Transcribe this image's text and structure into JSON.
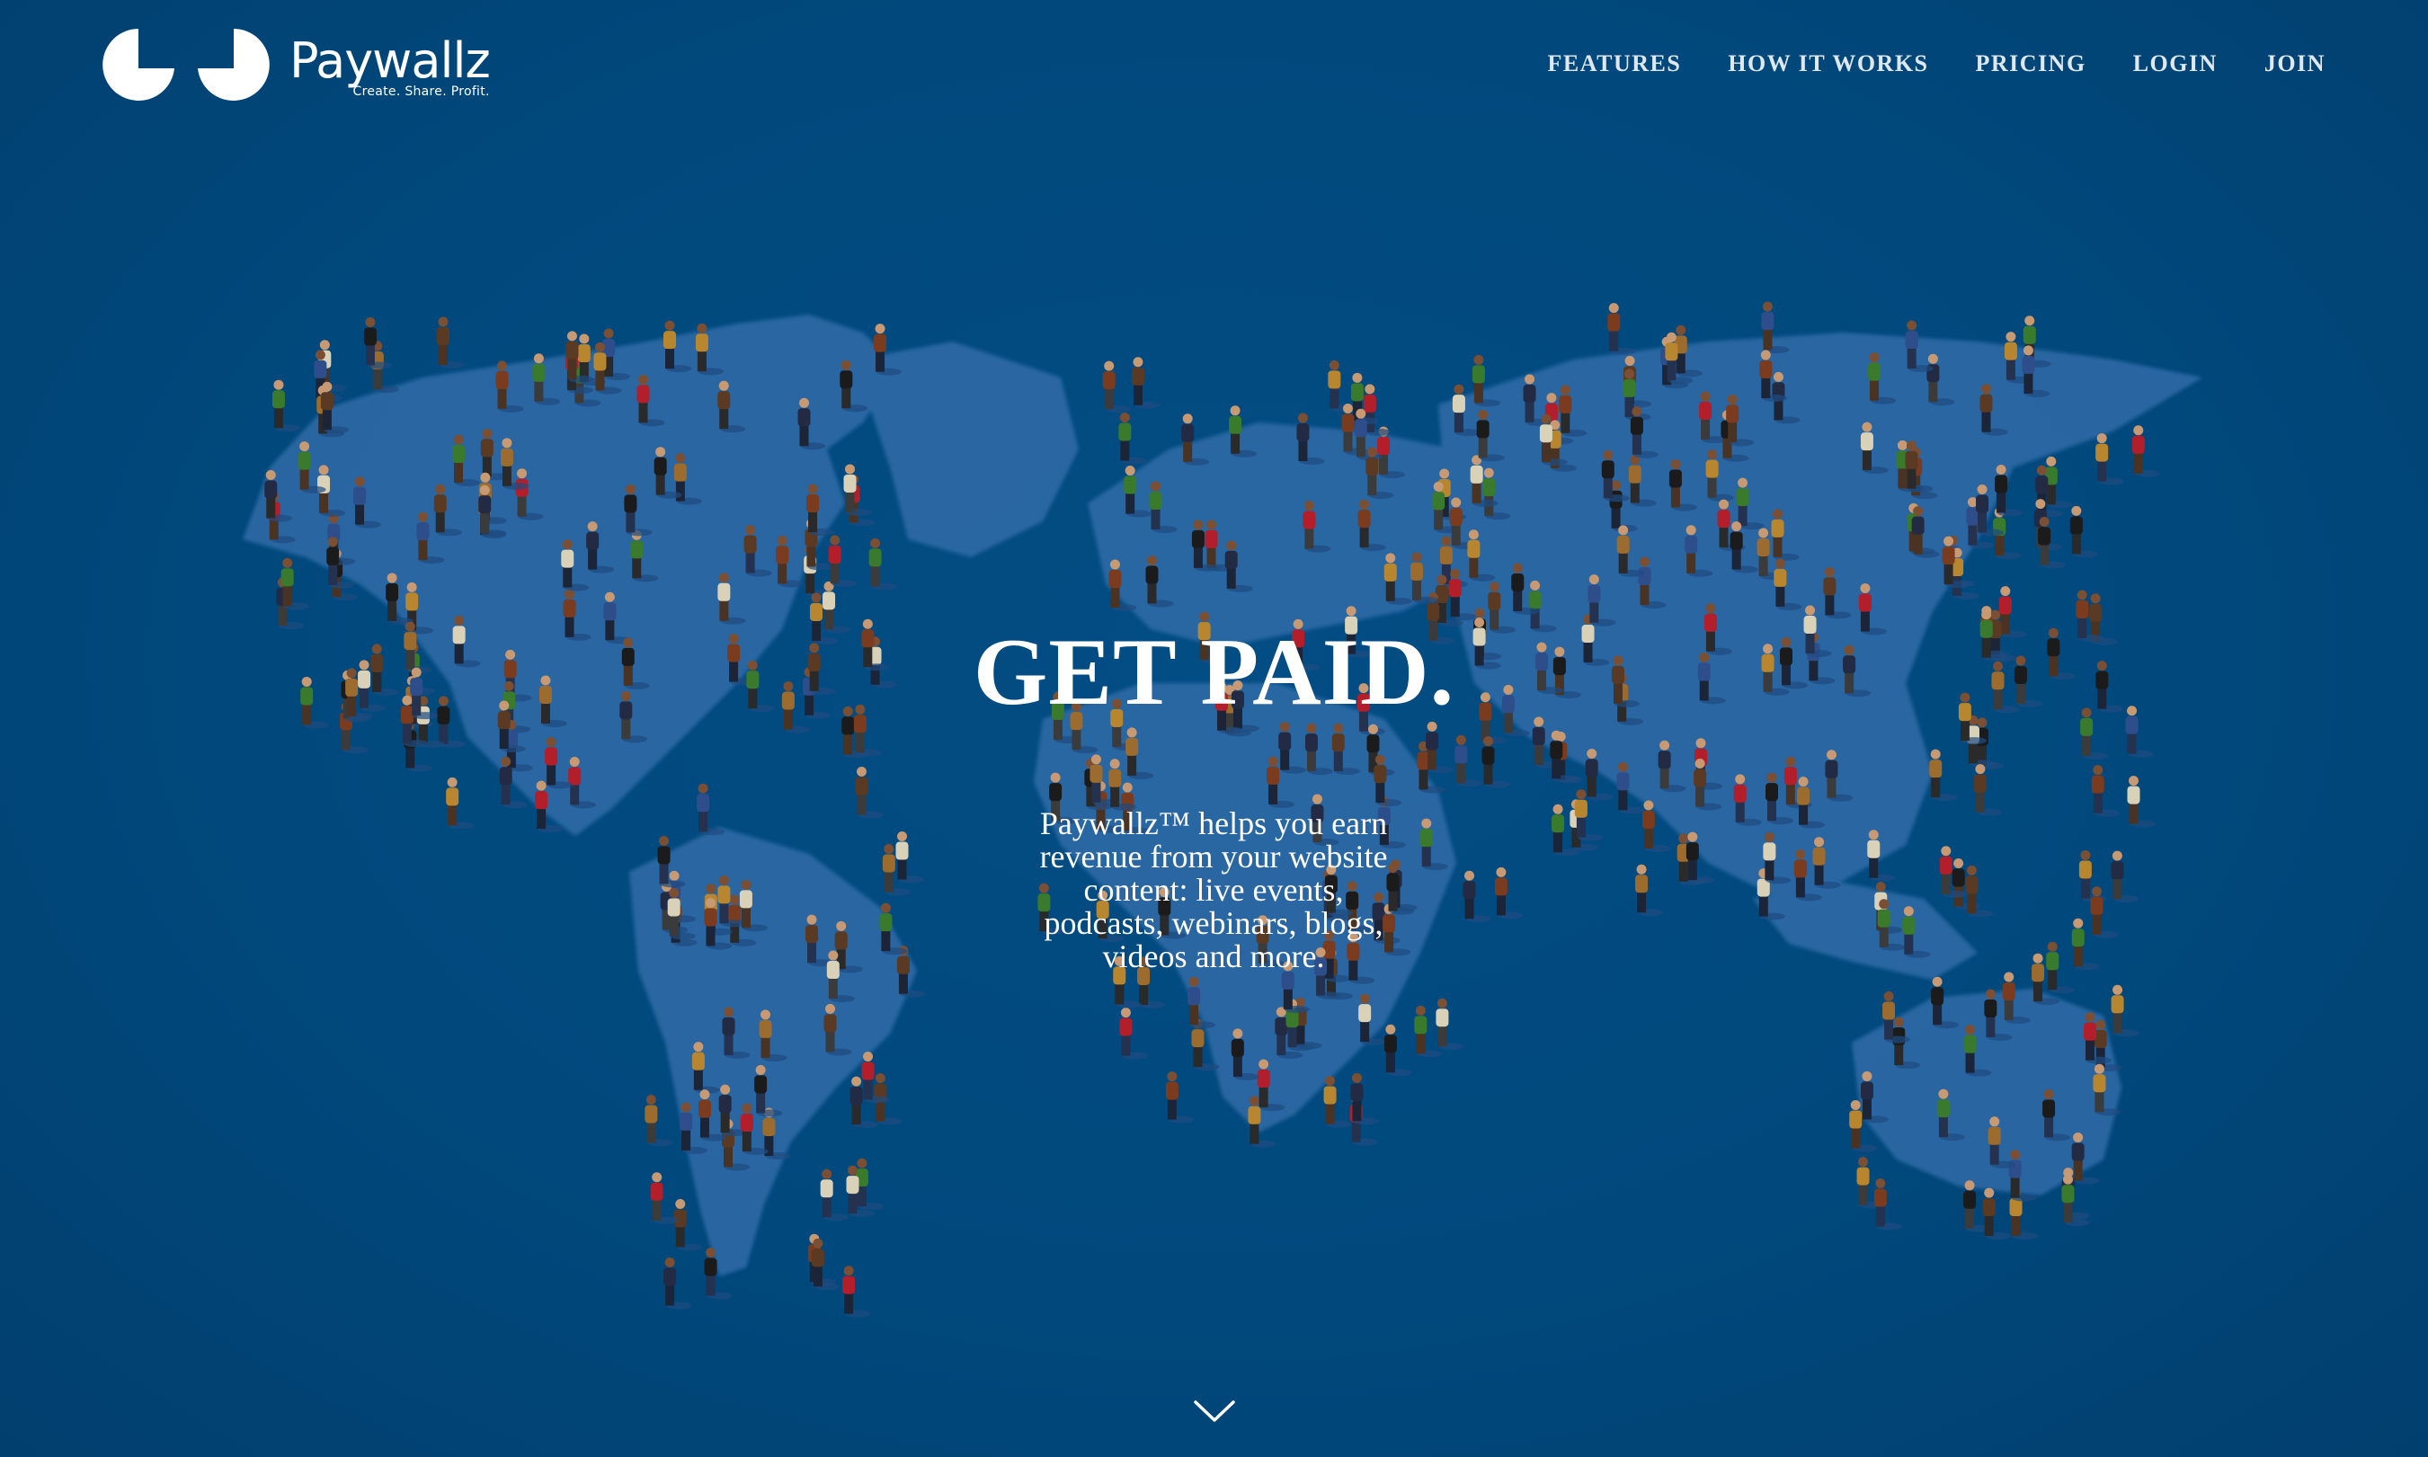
{
  "brand": {
    "name": "Paywallz",
    "tagline": "Create. Share. Profit."
  },
  "nav": {
    "items": [
      {
        "label": "FEATURES"
      },
      {
        "label": "HOW IT WORKS"
      },
      {
        "label": "PRICING"
      },
      {
        "label": "LOGIN"
      },
      {
        "label": "JOIN"
      }
    ]
  },
  "hero": {
    "title": "GET PAID.",
    "description": "Paywallz™ helps you earn revenue from your website content: live events, podcasts, webinars, blogs, videos and more.",
    "background": "world-map-of-people"
  },
  "icons": {
    "logo": "paywallz-logo-icon",
    "scroll": "chevron-down-icon"
  },
  "colors": {
    "background": "#01497d",
    "text": "#ffffff",
    "nav_text": "#dfe8f1"
  }
}
